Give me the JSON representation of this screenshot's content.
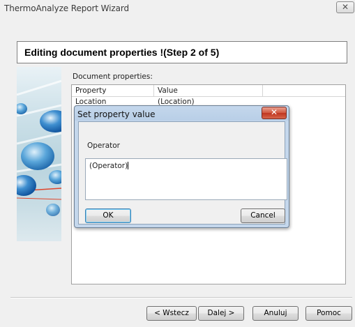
{
  "window": {
    "title": "ThermoAnalyze Report Wizard",
    "close_glyph": "✕"
  },
  "header": {
    "title": "Editing document properties !(Step 2 of 5)"
  },
  "main": {
    "label": "Document properties:",
    "columns": [
      "Property",
      "Value"
    ],
    "rows": [
      {
        "property": "Location",
        "value": "(Location)"
      }
    ]
  },
  "dialog": {
    "title": "Set property value",
    "close_glyph": "✕",
    "field_label": "Operator",
    "field_value": "(Operator)",
    "ok_label": "OK",
    "cancel_label": "Cancel"
  },
  "footer": {
    "back_label": "< Wstecz",
    "next_label": "Dalej >",
    "cancel_label": "Anuluj",
    "help_label": "Pomoc"
  },
  "colors": {
    "accent": "#3c7fb1",
    "dialog_frame": "#b9cfe7",
    "close_red": "#c03520"
  }
}
